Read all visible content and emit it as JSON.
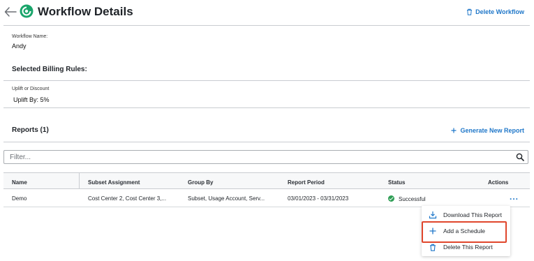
{
  "header": {
    "title": "Workflow Details",
    "delete_workflow": "Delete Workflow"
  },
  "workflow": {
    "name_label": "Workflow Name:",
    "name_value": "Andy"
  },
  "billing": {
    "section_title": "Selected Billing Rules:",
    "rule_label": "Uplift or Discount",
    "rule_value": "Uplift By: 5%"
  },
  "reports": {
    "section_title": "Reports (1)",
    "generate_label": "Generate New Report",
    "filter_placeholder": "Filter...",
    "columns": [
      "Name",
      "Subset Assignment",
      "Group By",
      "Report Period",
      "Status",
      "Actions"
    ],
    "rows": [
      {
        "name": "Demo",
        "subset": "Cost Center 2, Cost Center 3,...",
        "group_by": "Subset, Usage Account, Serv...",
        "period": "03/01/2023 - 03/31/2023",
        "status": "Successful",
        "actions": "..."
      }
    ]
  },
  "menu": {
    "items": [
      "Download This Report",
      "Add a Schedule",
      "Delete This Report"
    ]
  },
  "colors": {
    "accent": "#1f77c9",
    "success": "#2e9e55",
    "highlight": "#e0462c",
    "logo": "#1aa56b"
  }
}
